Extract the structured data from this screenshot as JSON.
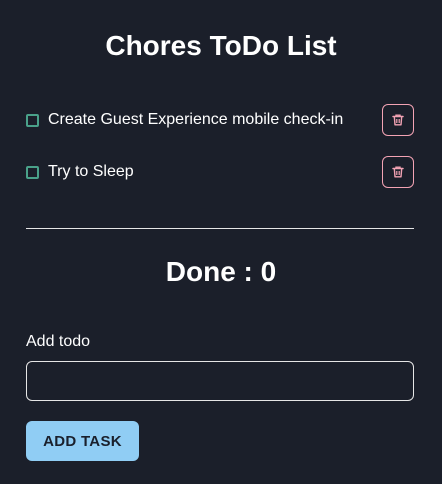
{
  "app": {
    "title": "Chores ToDo List"
  },
  "todos": [
    {
      "label": "Create Guest Experience mobile check-in",
      "checked": false
    },
    {
      "label": "Try to Sleep",
      "checked": false
    }
  ],
  "icons": {
    "delete": "trash-icon"
  },
  "done": {
    "text": "Done : 0"
  },
  "add_form": {
    "label": "Add todo",
    "input_value": "",
    "input_placeholder": "",
    "button_label": "ADD TASK"
  },
  "colors": {
    "background": "#1b1f2a",
    "checkbox_border": "#4aa18a",
    "delete_accent": "#f3a3b4",
    "button_bg": "#90cdf4",
    "button_text": "#1a202c"
  }
}
